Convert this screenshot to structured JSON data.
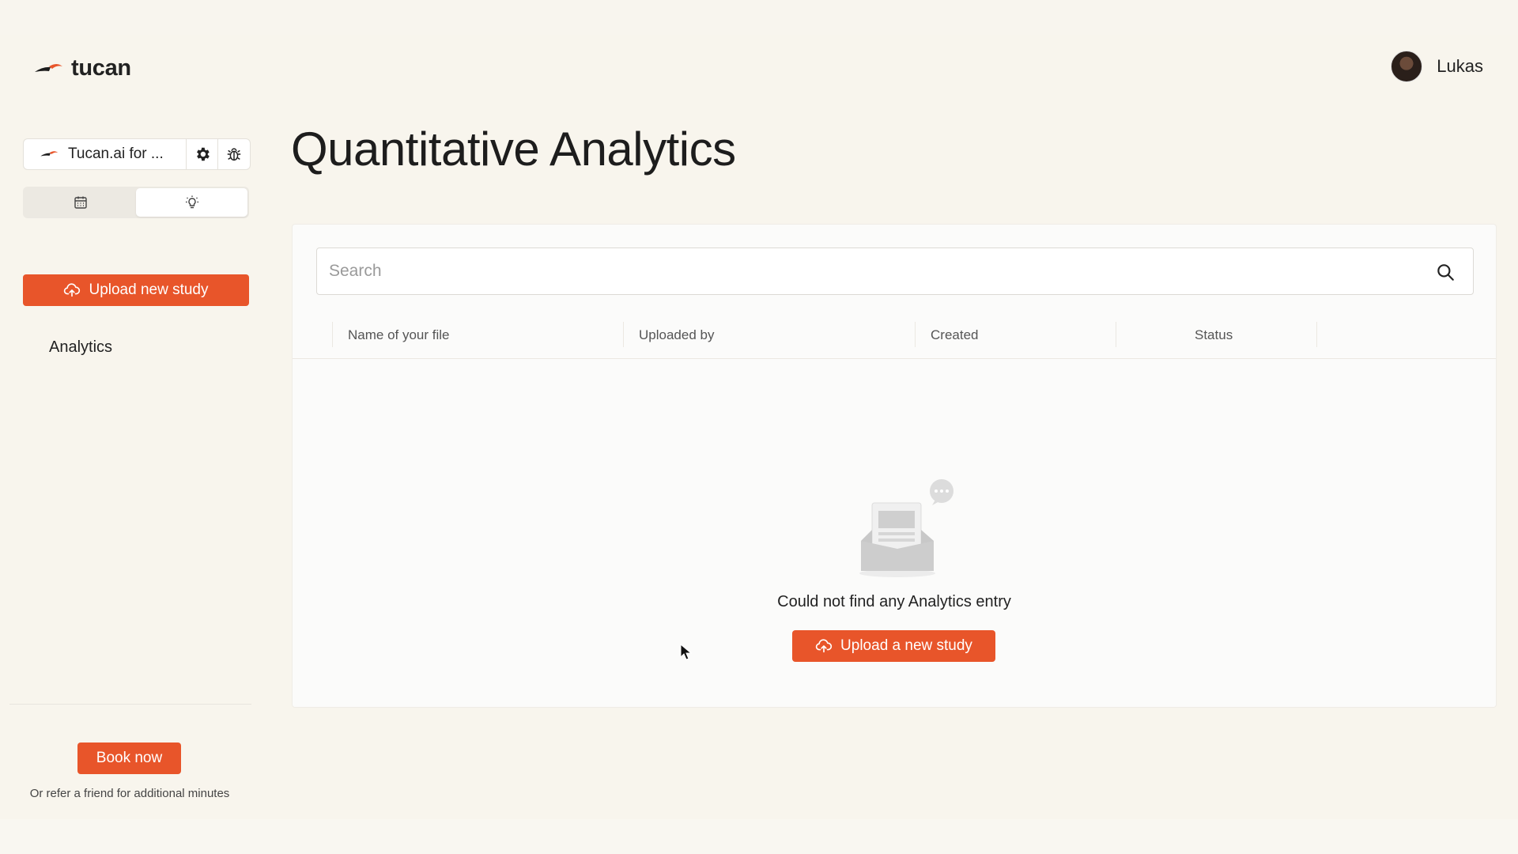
{
  "app": {
    "brand": "tucan"
  },
  "user": {
    "name": "Lukas"
  },
  "sidebar": {
    "workspace_label": "Tucan.ai for ...",
    "upload_button": "Upload new study",
    "nav_item": "Analytics",
    "book_now": "Book now",
    "refer_text": "Or refer a friend for additional minutes"
  },
  "main": {
    "title": "Quantitative Analytics",
    "search": {
      "placeholder": "Search"
    },
    "columns": [
      "Name of your file",
      "Uploaded by",
      "Created",
      "Status"
    ],
    "empty_state": {
      "message": "Could not find any Analytics entry",
      "button": "Upload a new study"
    }
  },
  "colors": {
    "accent": "#e8552a",
    "background": "#f8f5ed",
    "panel": "#fbfbfa"
  }
}
